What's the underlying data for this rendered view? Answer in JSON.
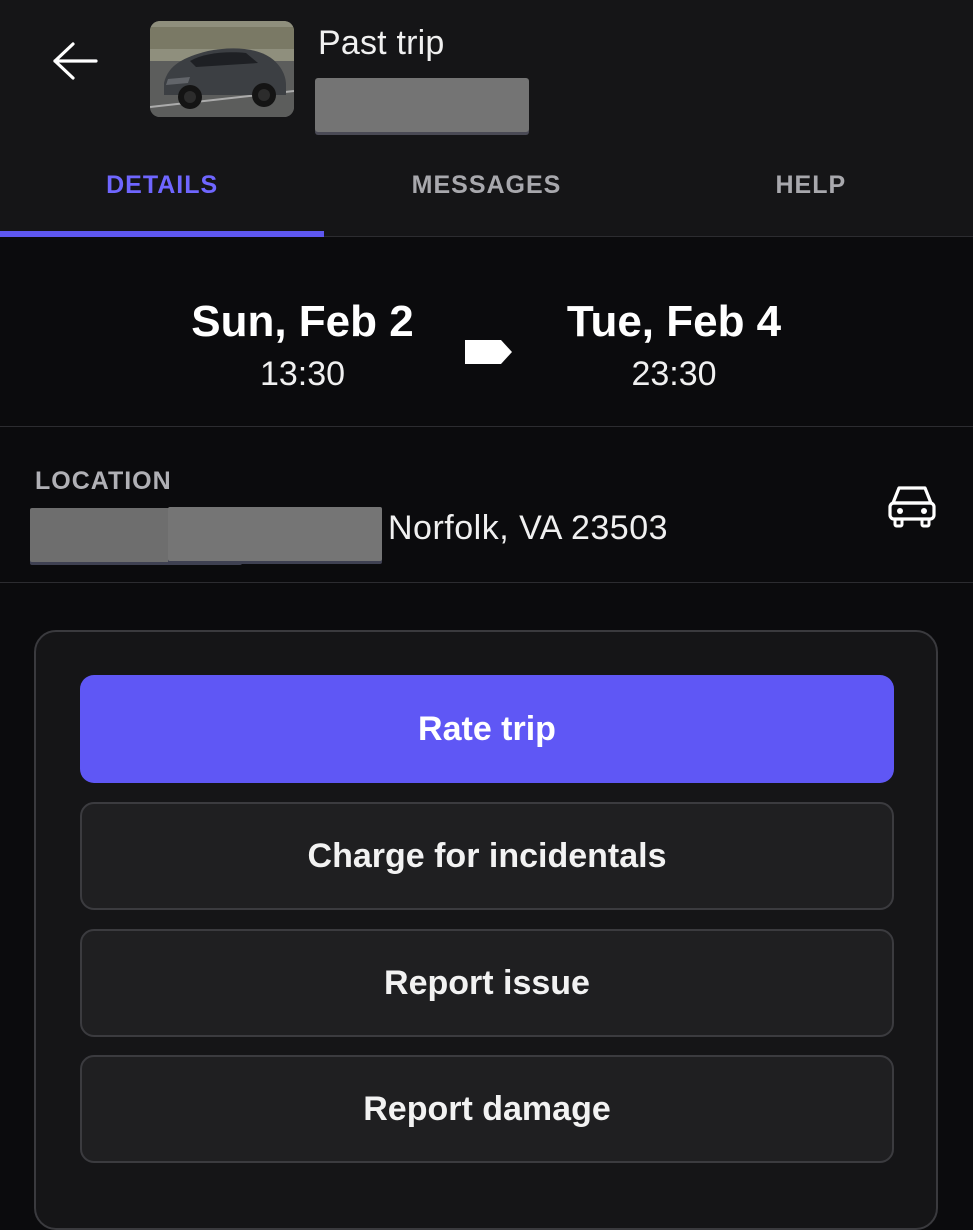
{
  "header": {
    "title": "Past trip",
    "back_icon": "arrow-left-icon",
    "thumbnail": "vehicle-photo"
  },
  "tabs": [
    {
      "label": "DETAILS",
      "active": true
    },
    {
      "label": "MESSAGES",
      "active": false
    },
    {
      "label": "HELP",
      "active": false
    }
  ],
  "trip": {
    "start": {
      "date": "Sun, Feb 2",
      "time": "13:30"
    },
    "end": {
      "date": "Tue, Feb 4",
      "time": "23:30"
    }
  },
  "location": {
    "label": "LOCATION",
    "address_visible": "Norfolk, VA 23503",
    "icon": "car-front-icon"
  },
  "actions": {
    "rate_trip": "Rate trip",
    "charge_incidentals": "Charge for incidentals",
    "report_issue": "Report issue",
    "report_damage": "Report damage"
  },
  "colors": {
    "accent": "#5f57f5",
    "active_tab": "#6f66ff",
    "background": "#0b0b0d",
    "surface": "#151517"
  }
}
